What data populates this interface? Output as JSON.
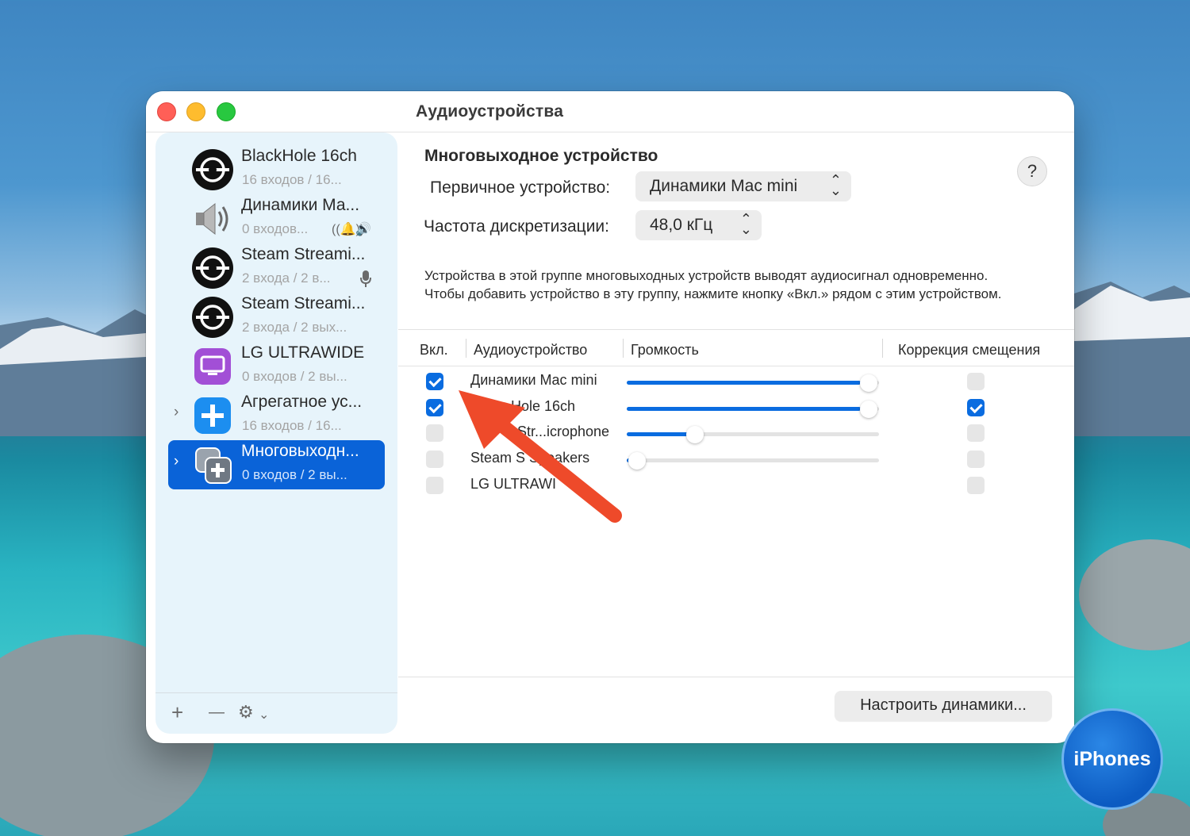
{
  "window": {
    "title": "Аудиоустройства"
  },
  "sidebar": {
    "devices": [
      {
        "name": "BlackHole 16ch",
        "sub": "16 входов / 16...",
        "icon": "blackhole-icon"
      },
      {
        "name": "Динамики Ма...",
        "sub": "0 входов...",
        "icon": "speaker-icon",
        "badges": [
          "alert-sound-icon",
          "output-volume-icon"
        ]
      },
      {
        "name": "Steam Streami...",
        "sub": "2 входа / 2 в...",
        "icon": "blackhole-icon",
        "badges": [
          "microphone-icon"
        ]
      },
      {
        "name": "Steam Streami...",
        "sub": "2 входа / 2 вых...",
        "icon": "blackhole-icon"
      },
      {
        "name": "LG ULTRAWIDE",
        "sub": "0 входов / 2 вы...",
        "icon": "display-icon"
      },
      {
        "name": "Агрегатное ус...",
        "sub": "16 входов / 16...",
        "icon": "aggregate-device-icon"
      },
      {
        "name": "Многовыходн...",
        "sub": "0 входов / 2 вы...",
        "icon": "multi-output-device-icon",
        "selected": true
      }
    ],
    "add_label": "+",
    "remove_label": "—",
    "gear_label": "⚙"
  },
  "detail": {
    "title": "Многовыходное устройство",
    "primary_label": "Первичное устройство:",
    "primary_value": "Динамики Mac mini",
    "rate_label": "Частота дискретизации:",
    "rate_value": "48,0 кГц",
    "help_label": "?",
    "description": "Устройства в этой группе многовыходных устройств выводят аудиосигнал одновременно. Чтобы добавить устройство в эту группу, нажмите кнопку «Вкл.» рядом с этим устройством.",
    "table": {
      "headers": {
        "on": "Вкл.",
        "device": "Аудиоустройство",
        "volume": "Громкость",
        "drift": "Коррекция смещения"
      },
      "rows": [
        {
          "on": true,
          "name": "Динамики Mac mini",
          "volume": 0.96,
          "drift": false
        },
        {
          "on": true,
          "name": "Hole 16ch",
          "volume": 0.96,
          "drift": true
        },
        {
          "on": false,
          "name": "Str...icrophone",
          "volume": 0.27,
          "drift": false
        },
        {
          "on": false,
          "name": "Steam S Speakers",
          "volume": 0.04,
          "drift": false
        },
        {
          "on": false,
          "name": "LG ULTRAWI",
          "volume": null,
          "drift": false
        }
      ]
    },
    "configure_button": "Настроить динамики..."
  },
  "watermark": "iPhones",
  "colors": {
    "accent": "#0a6ce0",
    "selection": "#0a63d8",
    "arrow": "#ee4a2a"
  }
}
